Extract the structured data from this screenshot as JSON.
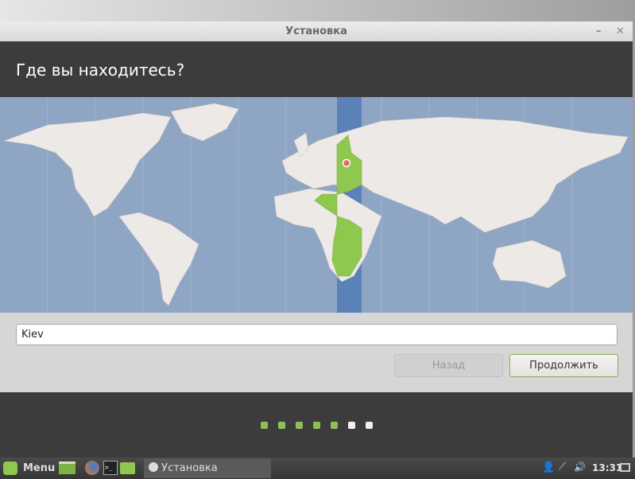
{
  "window": {
    "title": "Установка"
  },
  "header": {
    "title": "Где вы находитесь?"
  },
  "location": {
    "value": "Kiev"
  },
  "buttons": {
    "back": "Назад",
    "continue": "Продолжить"
  },
  "progress": {
    "total_steps": 7,
    "completed_steps": 5
  },
  "taskbar": {
    "menu_label": "Menu",
    "task_label": "Установка",
    "clock": "13:31"
  },
  "colors": {
    "accent": "#8fbd5a",
    "timezone_highlight": "#5a82b8",
    "map_ocean": "#8fa5c4"
  }
}
